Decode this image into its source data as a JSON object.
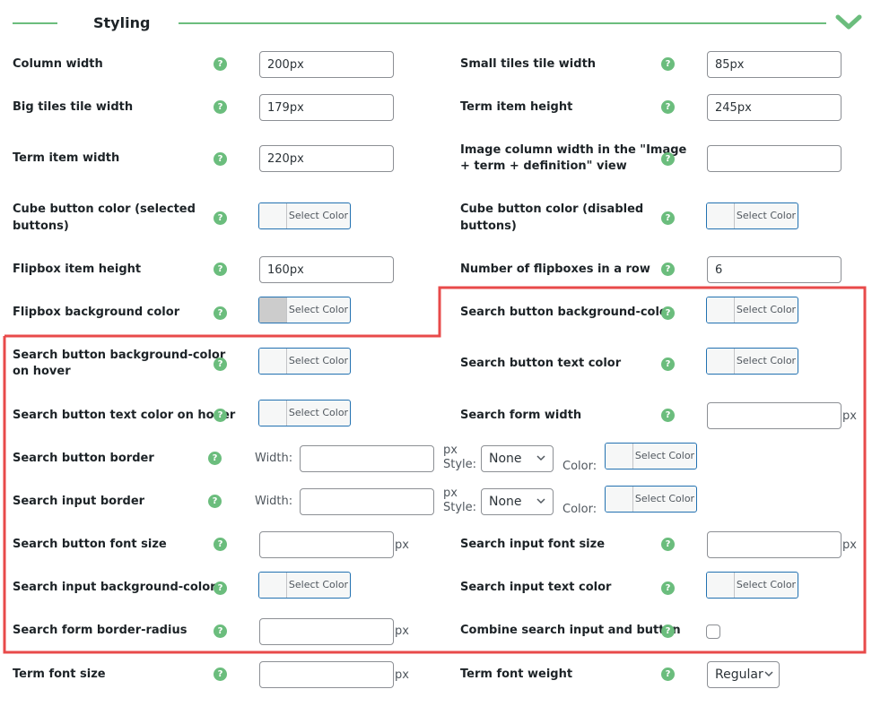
{
  "section": {
    "title": "Styling",
    "accent": "#6bbd7d",
    "highlight": "#e84a4a"
  },
  "help_glyph": "?",
  "color_button_label": "Select Color",
  "unit_px": "px",
  "rows": {
    "column_width": {
      "label": "Column width",
      "value": "200px"
    },
    "small_tiles_tile_width": {
      "label": "Small tiles tile width",
      "value": "85px"
    },
    "big_tiles_tile_width": {
      "label": "Big tiles tile width",
      "value": "179px"
    },
    "term_item_height": {
      "label": "Term item height",
      "value": "245px"
    },
    "term_item_width": {
      "label": "Term item width",
      "value": "220px"
    },
    "image_column_width": {
      "label_line1": "Image column width in the \"Image",
      "label_line2": "+ term + definition\" view",
      "value": ""
    },
    "cube_selected": {
      "label_line1": "Cube button color (selected",
      "label_line2": "buttons)"
    },
    "cube_disabled": {
      "label_line1": "Cube button color (disabled",
      "label_line2": "buttons)"
    },
    "flipbox_item_height": {
      "label": "Flipbox item height",
      "value": "160px"
    },
    "flipboxes_in_row": {
      "label": "Number of flipboxes in a row",
      "value": "6"
    },
    "flipbox_bg": {
      "label": "Flipbox background color",
      "swatch": "#cccccc"
    },
    "search_btn_bg": {
      "label": "Search button background-color"
    },
    "search_btn_bg_hover": {
      "label_line1": "Search button background-color",
      "label_line2": "on hover"
    },
    "search_btn_text": {
      "label": "Search button text color"
    },
    "search_btn_text_hover": {
      "label": "Search button text color on hover"
    },
    "search_form_width": {
      "label": "Search form width",
      "value": ""
    },
    "search_btn_border": {
      "label": "Search button border",
      "width_label": "Width:",
      "width_value": "",
      "style_label": "Style:",
      "style_value": "None",
      "color_label": "Color:"
    },
    "search_input_border": {
      "label": "Search input border",
      "width_label": "Width:",
      "width_value": "",
      "style_label": "Style:",
      "style_value": "None",
      "color_label": "Color:"
    },
    "search_btn_font_size": {
      "label": "Search button font size",
      "value": ""
    },
    "search_input_font_size": {
      "label": "Search input font size",
      "value": ""
    },
    "search_input_bg": {
      "label": "Search input background-color"
    },
    "search_input_text": {
      "label": "Search input text color"
    },
    "search_form_radius": {
      "label": "Search form border-radius",
      "value": ""
    },
    "combine": {
      "label": "Combine search input and button",
      "checked": false
    },
    "term_font_size": {
      "label": "Term font size",
      "value": ""
    },
    "term_font_weight": {
      "label": "Term font weight",
      "value": "Regular"
    }
  }
}
